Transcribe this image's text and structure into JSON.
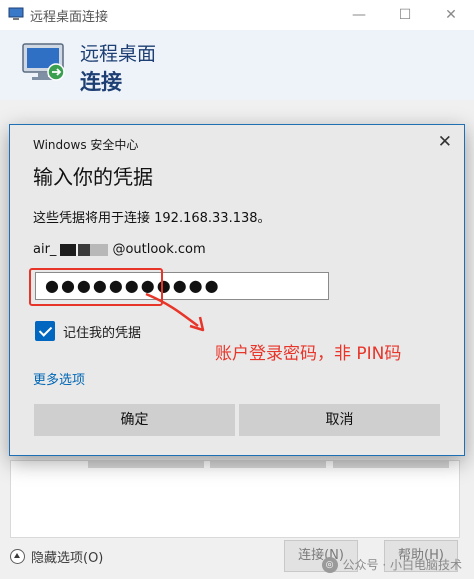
{
  "window": {
    "title": "远程桌面连接",
    "header_line1": "远程桌面",
    "header_line2": "连接",
    "minimize": "—",
    "maximize": "☐",
    "close": "✕"
  },
  "background": {
    "show_options": "隐藏选项(O)",
    "connect_button": "连接(N)",
    "help_button": "帮助(H)",
    "watermark": "公众号 · 小白电脑技术"
  },
  "dialog": {
    "title": "Windows 安全中心",
    "close": "✕",
    "heading": "输入你的凭据",
    "description": "这些凭据将用于连接 192.168.33.138。",
    "account_prefix": "air_",
    "account_suffix": "@outlook.com",
    "password_value": "●●●●●●●●●●●",
    "remember_label": "记住我的凭据",
    "remember_checked": true,
    "more_options": "更多选项",
    "ok_button": "确定",
    "cancel_button": "取消"
  },
  "annotation": {
    "text": "账户登录密码，非 PIN码",
    "color": "#e8352a"
  },
  "colors": {
    "accent": "#0067c0",
    "header_text": "#1d3f74",
    "link": "#0066b4"
  }
}
